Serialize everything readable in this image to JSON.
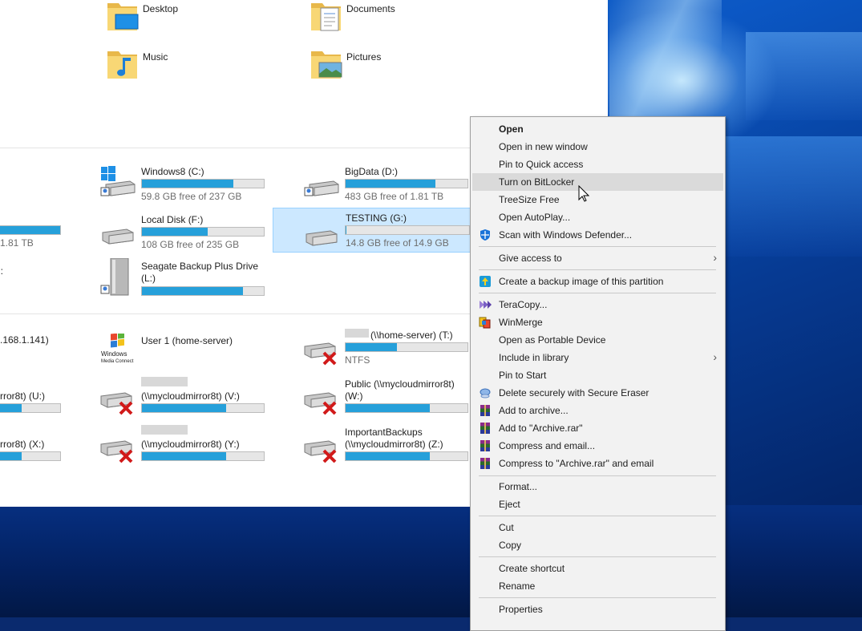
{
  "folders": [
    {
      "name": "Desktop",
      "icon": "desktop-folder-icon"
    },
    {
      "name": "Documents",
      "icon": "documents-folder-icon"
    },
    {
      "name": "Music",
      "icon": "music-folder-icon"
    },
    {
      "name": "Pictures",
      "icon": "pictures-folder-icon"
    }
  ],
  "drives": {
    "partial_left_1": {
      "free": "1.81 TB",
      "fill": 1.0
    },
    "partial_left_2": {
      "name": "l:"
    },
    "partial_left_3": {
      "name": ".168.1.141)"
    },
    "partial_left_4": {
      "name": "rror8t) (U:)",
      "fill": 0.37
    },
    "partial_left_5": {
      "name": "rror8t) (X:)",
      "fill": 0.37
    },
    "windows8": {
      "name": "Windows8 (C:)",
      "free": "59.8 GB free of 237 GB",
      "fill": 0.75
    },
    "bigdata": {
      "name": "BigData (D:)",
      "free": "483 GB free of 1.81 TB",
      "fill": 0.74
    },
    "localdisk": {
      "name": "Local Disk (F:)",
      "free": "108 GB free of 235 GB",
      "fill": 0.54
    },
    "testing": {
      "name": "TESTING (G:)",
      "free": "14.8 GB free of 14.9 GB",
      "fill": 0.005
    },
    "seagate": {
      "name": "Seagate Backup Plus Drive",
      "name2": "(L:)",
      "fill": 0.83
    },
    "user1": {
      "name": "User 1 (home-server)",
      "icon_text": "Windows Media Connect"
    },
    "homeserver_t": {
      "name": "(\\\\home-server) (T:)",
      "free": "NTFS",
      "fill": 0.42
    },
    "cloud_v": {
      "name": "(\\\\mycloudmirror8t) (V:)",
      "fill": 0.69
    },
    "public_w": {
      "name": "Public (\\\\mycloudmirror8t)",
      "name2": "(W:)",
      "fill": 0.69
    },
    "cloud_y": {
      "name": "(\\\\mycloudmirror8t) (Y:)",
      "fill": 0.69
    },
    "important_z": {
      "name": "ImportantBackups",
      "name2": "(\\\\mycloudmirror8t) (Z:)",
      "fill": 0.69
    }
  },
  "menu": [
    {
      "label": "Open",
      "bold": true
    },
    {
      "label": "Open in new window"
    },
    {
      "label": "Pin to Quick access"
    },
    {
      "label": "Turn on BitLocker",
      "highlighted": true
    },
    {
      "label": "TreeSize Free"
    },
    {
      "label": "Open AutoPlay..."
    },
    {
      "label": "Scan with Windows Defender...",
      "icon": "windows-defender-icon"
    },
    {
      "label": "Give access to",
      "submenu": true
    },
    {
      "label": "Create a backup image of this partition",
      "icon": "backup-image-icon"
    },
    {
      "label": "TeraCopy...",
      "icon": "teracopy-icon"
    },
    {
      "label": "WinMerge",
      "icon": "winmerge-icon"
    },
    {
      "label": "Open as Portable Device"
    },
    {
      "label": "Include in library",
      "submenu": true
    },
    {
      "label": "Pin to Start"
    },
    {
      "label": "Delete securely with Secure Eraser",
      "icon": "secure-eraser-icon"
    },
    {
      "label": "Add to archive...",
      "icon": "winrar-icon"
    },
    {
      "label": "Add to \"Archive.rar\"",
      "icon": "winrar-icon"
    },
    {
      "label": "Compress and email...",
      "icon": "winrar-icon"
    },
    {
      "label": "Compress to \"Archive.rar\" and email",
      "icon": "winrar-icon"
    },
    {
      "label": "Format..."
    },
    {
      "label": "Eject"
    },
    {
      "label": "Cut"
    },
    {
      "label": "Copy"
    },
    {
      "label": "Create shortcut"
    },
    {
      "label": "Rename"
    },
    {
      "label": "Properties"
    }
  ],
  "colors": {
    "accent": "#26a0da",
    "selection": "#cce8ff",
    "menu_bg": "#f2f2f2",
    "highlight": "#dadada"
  }
}
